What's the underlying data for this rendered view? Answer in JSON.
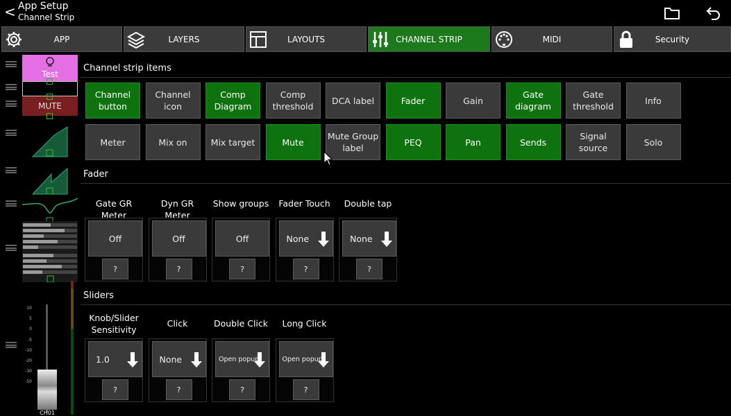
{
  "header": {
    "back_symbol": "<",
    "title": "App Setup",
    "subtitle": "Channel Strip",
    "icons": [
      "folder-icon",
      "undo-icon"
    ]
  },
  "tabs": [
    {
      "label": "APP",
      "icon": "gear-icon",
      "active": false
    },
    {
      "label": "LAYERS",
      "icon": "layers-icon",
      "active": false
    },
    {
      "label": "LAYOUTS",
      "icon": "layout-icon",
      "active": false
    },
    {
      "label": "CHANNEL STRIP",
      "icon": "sliders-icon",
      "active": true
    },
    {
      "label": "MIDI",
      "icon": "midi-icon",
      "active": false
    },
    {
      "label": "Security",
      "icon": "lock-icon",
      "active": false
    }
  ],
  "strip_preview": {
    "channel_button": "Test",
    "mute": "MUTE",
    "fader_scale": [
      "10",
      "5",
      "0",
      "-5",
      "-10",
      "-20",
      "-30",
      "-50"
    ],
    "channel_name": "CH01"
  },
  "channel_strip_items": {
    "heading": "Channel strip items",
    "items": [
      {
        "label": "Channel button",
        "on": true
      },
      {
        "label": "Channel icon",
        "on": false
      },
      {
        "label": "Comp Diagram",
        "on": true
      },
      {
        "label": "Comp threshold",
        "on": false
      },
      {
        "label": "DCA label",
        "on": false
      },
      {
        "label": "Fader",
        "on": true
      },
      {
        "label": "Gain",
        "on": false
      },
      {
        "label": "Gate diagram",
        "on": true
      },
      {
        "label": "Gate threshold",
        "on": false
      },
      {
        "label": "Info",
        "on": false
      },
      {
        "label": "Meter",
        "on": false
      },
      {
        "label": "Mix on",
        "on": false
      },
      {
        "label": "Mix target",
        "on": false
      },
      {
        "label": "Mute",
        "on": true
      },
      {
        "label": "Mute Group label",
        "on": false
      },
      {
        "label": "PEQ",
        "on": true
      },
      {
        "label": "Pan",
        "on": true
      },
      {
        "label": "Sends",
        "on": true
      },
      {
        "label": "Signal source",
        "on": false
      },
      {
        "label": "Solo",
        "on": false
      }
    ]
  },
  "fader": {
    "heading": "Fader",
    "controls": [
      {
        "label": "Gate GR Meter",
        "value": "Off",
        "dropdown": false,
        "help": "?"
      },
      {
        "label": "Dyn GR Meter",
        "value": "Off",
        "dropdown": false,
        "help": "?"
      },
      {
        "label": "Show groups",
        "value": "Off",
        "dropdown": false,
        "help": "?"
      },
      {
        "label": "Fader Touch",
        "value": "None",
        "dropdown": true,
        "help": "?"
      },
      {
        "label": "Double tap",
        "value": "None",
        "dropdown": true,
        "help": "?"
      }
    ]
  },
  "sliders": {
    "heading": "Sliders",
    "controls": [
      {
        "label": "Knob/Slider Sensitivity",
        "value": "1.0",
        "dropdown": true,
        "help": "?"
      },
      {
        "label": "Click",
        "value": "None",
        "dropdown": true,
        "help": "?"
      },
      {
        "label": "Double Click",
        "value": "Open popup",
        "dropdown": true,
        "help": "?"
      },
      {
        "label": "Long Click",
        "value": "Open popup",
        "dropdown": true,
        "help": "?"
      }
    ]
  },
  "colors": {
    "active_green": "#1c7a1c",
    "item_on": "#0e730e",
    "button_gray": "#3a3a3a",
    "channel_pink": "#e46ee4",
    "mute_red": "#7a1f1f",
    "diagram_green": "#2faa7a"
  }
}
